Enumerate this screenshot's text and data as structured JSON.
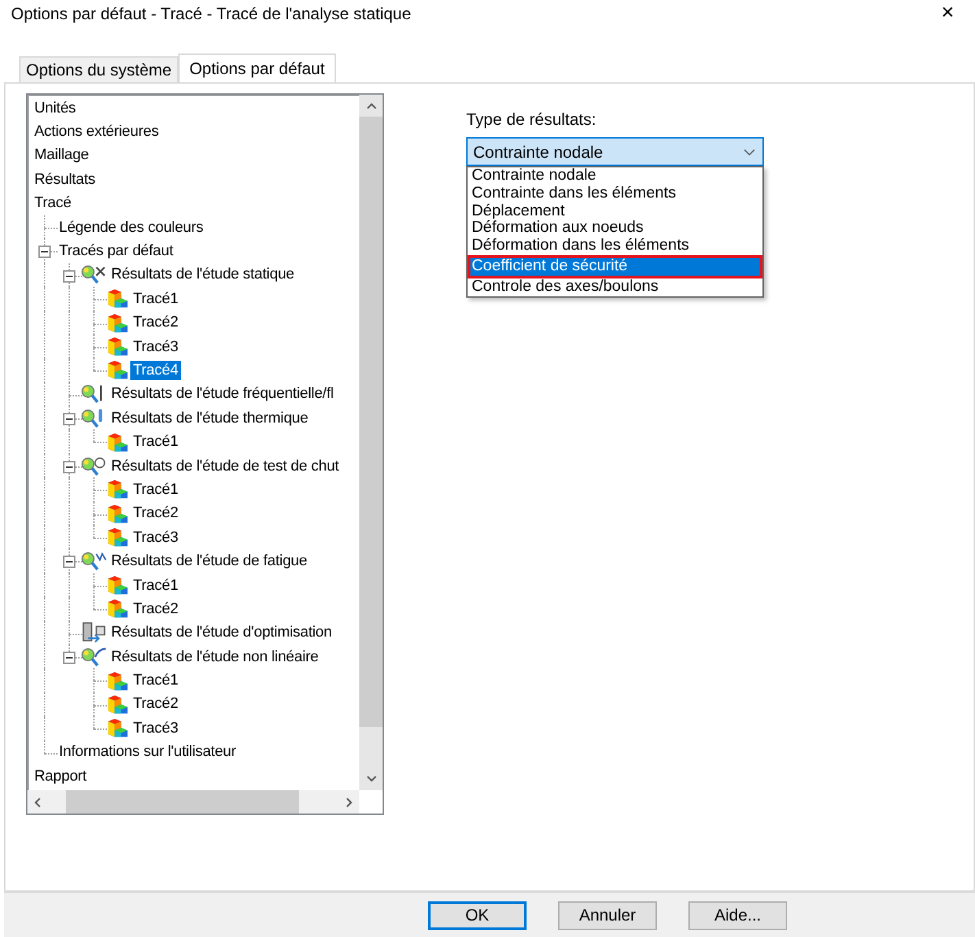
{
  "window": {
    "title": "Options par défaut - Tracé - Tracé de l'analyse statique",
    "close": "×"
  },
  "tabs": [
    {
      "label": "Options du système",
      "selected": false
    },
    {
      "label": "Options par défaut",
      "selected": true
    }
  ],
  "tree": {
    "items": [
      {
        "label": "Unités",
        "selected": false
      },
      {
        "label": "Actions extérieures",
        "selected": false
      },
      {
        "label": "Maillage",
        "selected": false
      },
      {
        "label": "Résultats",
        "selected": false
      },
      {
        "label": "Tracé",
        "selected": false,
        "children": [
          {
            "label": "Légende des couleurs",
            "selected": false
          },
          {
            "label": "Tracés par défaut",
            "selected": false,
            "expanded": true,
            "children": [
              {
                "label": "Résultats de l'étude statique",
                "kind": "static",
                "selected": false,
                "expanded": true,
                "children": [
                  {
                    "label": "Tracé1",
                    "kind": "plot",
                    "selected": false
                  },
                  {
                    "label": "Tracé2",
                    "kind": "plot",
                    "selected": false
                  },
                  {
                    "label": "Tracé3",
                    "kind": "plot",
                    "selected": false
                  },
                  {
                    "label": "Tracé4",
                    "kind": "plot",
                    "selected": true
                  }
                ]
              },
              {
                "label": "Résultats de l'étude fréquentielle/fl",
                "kind": "frequency",
                "selected": false
              },
              {
                "label": "Résultats de l'étude thermique",
                "kind": "thermal",
                "selected": false,
                "expanded": true,
                "children": [
                  {
                    "label": "Tracé1",
                    "kind": "plot",
                    "selected": false
                  }
                ]
              },
              {
                "label": "Résultats de l'étude de test de chut",
                "kind": "drop",
                "selected": false,
                "expanded": true,
                "children": [
                  {
                    "label": "Tracé1",
                    "kind": "plot",
                    "selected": false
                  },
                  {
                    "label": "Tracé2",
                    "kind": "plot",
                    "selected": false
                  },
                  {
                    "label": "Tracé3",
                    "kind": "plot",
                    "selected": false
                  }
                ]
              },
              {
                "label": "Résultats de l'étude de fatigue",
                "kind": "fatigue",
                "selected": false,
                "expanded": true,
                "children": [
                  {
                    "label": "Tracé1",
                    "kind": "plot",
                    "selected": false
                  },
                  {
                    "label": "Tracé2",
                    "kind": "plot",
                    "selected": false
                  }
                ]
              },
              {
                "label": "Résultats de l'étude d'optimisation",
                "kind": "optimization",
                "selected": false
              },
              {
                "label": "Résultats de l'étude non linéaire",
                "kind": "nonlinear",
                "selected": false,
                "expanded": true,
                "children": [
                  {
                    "label": "Tracé1",
                    "kind": "plot",
                    "selected": false
                  },
                  {
                    "label": "Tracé2",
                    "kind": "plot",
                    "selected": false
                  },
                  {
                    "label": "Tracé3",
                    "kind": "plot",
                    "selected": false
                  }
                ]
              }
            ]
          },
          {
            "label": "Informations sur l'utilisateur",
            "selected": false
          }
        ]
      },
      {
        "label": "Rapport",
        "selected": false
      }
    ]
  },
  "result_type": {
    "label": "Type de résultats:",
    "value": "Contrainte nodale",
    "options": [
      {
        "label": "Contrainte nodale",
        "highlighted": false
      },
      {
        "label": "Contrainte dans les éléments",
        "highlighted": false
      },
      {
        "label": "Déplacement",
        "highlighted": false
      },
      {
        "label": "Déformation aux noeuds",
        "highlighted": false
      },
      {
        "label": "Déformation dans les éléments",
        "highlighted": false
      },
      {
        "label": "Coefficient de sécurité",
        "highlighted": true
      },
      {
        "label": "Controle des axes/boulons",
        "highlighted": false
      }
    ]
  },
  "buttons": [
    {
      "label": "OK",
      "default": true
    },
    {
      "label": "Annuler",
      "default": false
    },
    {
      "label": "Aide...",
      "default": false
    }
  ]
}
